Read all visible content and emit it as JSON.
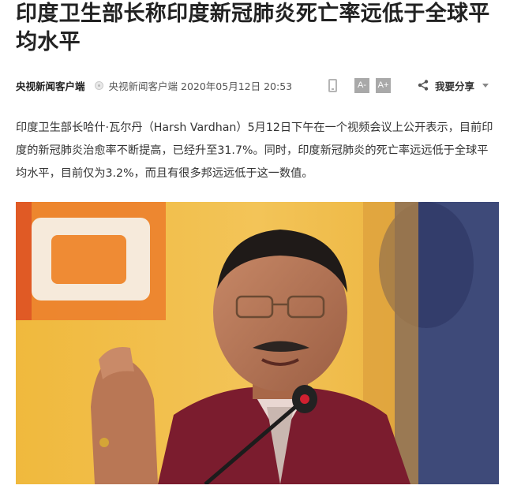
{
  "article": {
    "title": "印度卫生部长称印度新冠肺炎死亡率远低于全球平均水平",
    "source": "央视新闻客户端",
    "meta_info": "央视新闻客户端 2020年05月12日 20:53",
    "paragraph": "印度卫生部长哈什·瓦尔丹（Harsh Vardhan）5月12日下午在一个视频会议上公开表示，目前印度的新冠肺炎治愈率不断提高，已经升至31.7%。同时，印度新冠肺炎的死亡率远远低于全球平均水平，目前仅为3.2%，而且有很多邦远远低于这一数值。"
  },
  "toolbar": {
    "font_smaller_label": "A-",
    "font_larger_label": "A+",
    "share_label": "我要分享",
    "icons": [
      "info-dot-icon",
      "phone-icon",
      "share-icon",
      "caret-down-icon"
    ]
  },
  "colors": {
    "title": "#222222",
    "button_gray": "#a9a9a9",
    "photo_background": "#e8b23a"
  }
}
